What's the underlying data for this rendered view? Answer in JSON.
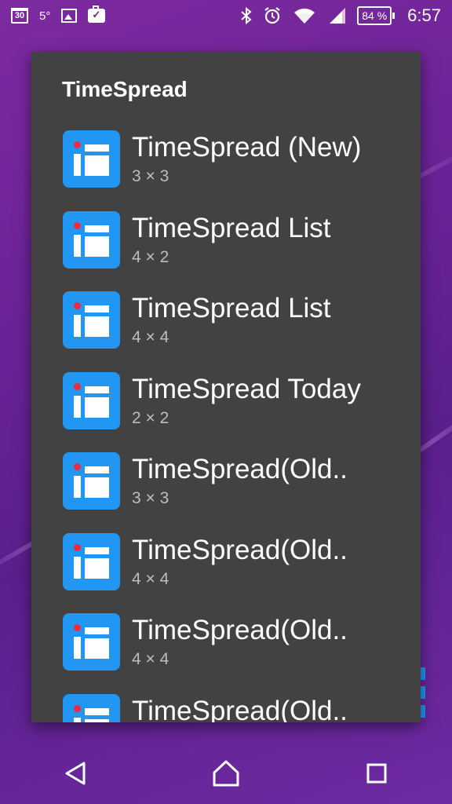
{
  "status_bar": {
    "calendar_day": "30",
    "temperature": "5°",
    "battery_percent": "84 %",
    "time": "6:57",
    "icons": [
      "calendar-icon",
      "image-icon",
      "briefcase-check-icon",
      "bluetooth-icon",
      "alarm-icon",
      "wifi-icon",
      "signal-icon",
      "battery-icon"
    ]
  },
  "dialog": {
    "title": "TimeSpread",
    "widgets": [
      {
        "name": "TimeSpread (New)",
        "size": "3 × 3"
      },
      {
        "name": "TimeSpread List",
        "size": "4 × 2"
      },
      {
        "name": "TimeSpread List",
        "size": "4 × 4"
      },
      {
        "name": "TimeSpread Today",
        "size": "2 × 2"
      },
      {
        "name": "TimeSpread(Old..",
        "size": "3 × 3"
      },
      {
        "name": "TimeSpread(Old..",
        "size": "4 × 4"
      },
      {
        "name": "TimeSpread(Old..",
        "size": "4 × 4"
      },
      {
        "name": "TimeSpread(Old..",
        "size": ""
      }
    ]
  },
  "nav_bar": {
    "icons": [
      "back-icon",
      "home-icon",
      "recents-icon"
    ]
  },
  "colors": {
    "dialog_bg": "#424242",
    "app_icon_blue": "#2196f3",
    "app_icon_dot": "#f4283c",
    "wallpaper": "#6a2396"
  }
}
